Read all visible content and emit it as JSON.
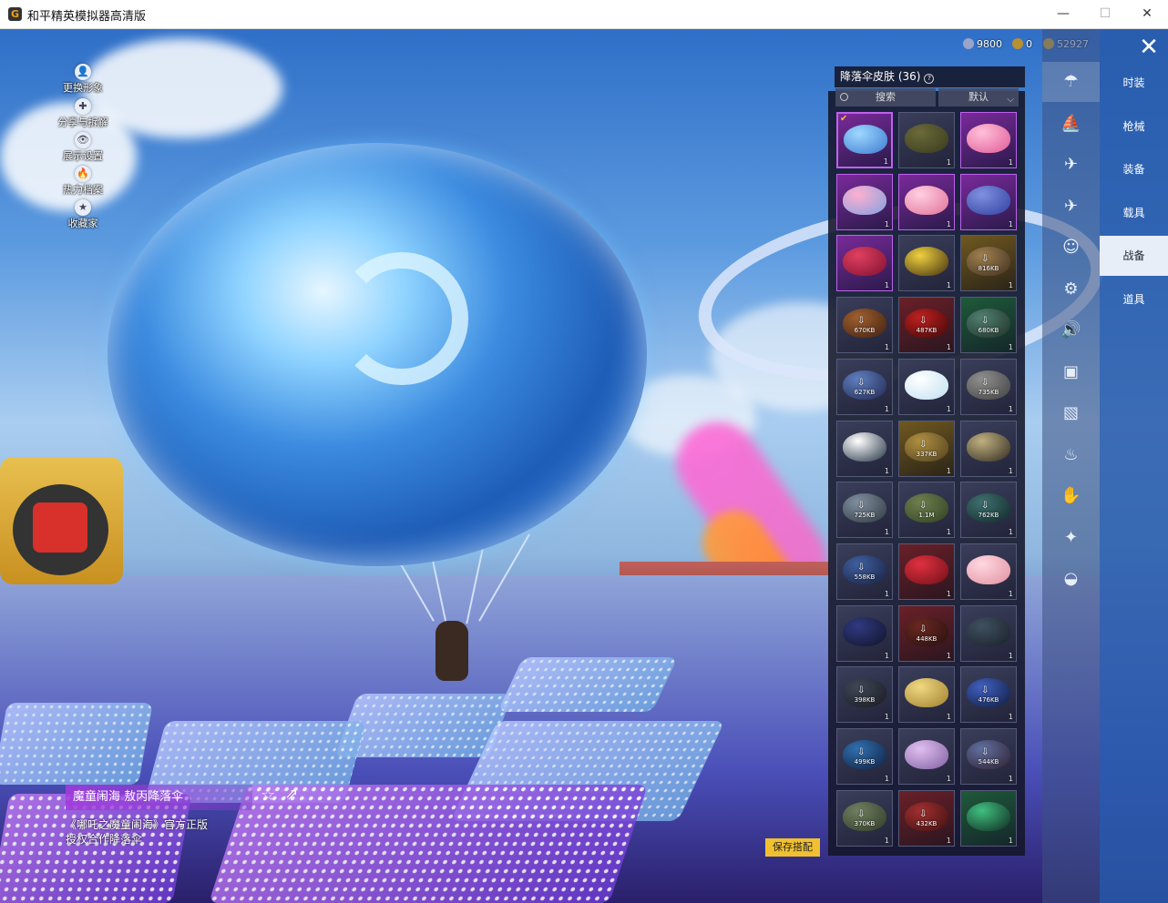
{
  "window": {
    "title": "和平精英模拟器高清版",
    "minimize": "—",
    "maximize": "☐",
    "close": "✕"
  },
  "left_menu": [
    {
      "label": "更换形象",
      "icon": "avatar-icon",
      "glyph": "👤"
    },
    {
      "label": "分享与拆解",
      "icon": "share-split-icon",
      "glyph": "✚"
    },
    {
      "label": "展示设置",
      "icon": "eye-icon",
      "glyph": "👁"
    },
    {
      "label": "热力档案",
      "icon": "flame-icon",
      "glyph": "🔥"
    },
    {
      "label": "收藏家",
      "icon": "collector-icon",
      "glyph": "★"
    }
  ],
  "currency": {
    "gems": "9800",
    "tokens": "0",
    "coins": "52927"
  },
  "panel": {
    "title": "降落伞皮肤 (36)",
    "help": "?",
    "search": "搜索",
    "sort": "默认",
    "sort_chevron": "⌵"
  },
  "skins": [
    {
      "style": "sel-blue",
      "size": "",
      "count": "1",
      "selected": true
    },
    {
      "style": "olive",
      "size": "",
      "count": "1"
    },
    {
      "style": "pink",
      "size": "",
      "count": "1"
    },
    {
      "style": "pink2",
      "size": "",
      "count": "1"
    },
    {
      "style": "pink3",
      "size": "",
      "count": "1"
    },
    {
      "style": "violet",
      "size": "",
      "count": "1"
    },
    {
      "style": "red",
      "size": "",
      "count": "1"
    },
    {
      "style": "yellow",
      "size": "",
      "count": "1"
    },
    {
      "style": "gold",
      "size": "816KB",
      "count": "1",
      "download": true
    },
    {
      "style": "brown",
      "size": "670KB",
      "count": "1",
      "download": true
    },
    {
      "style": "red2",
      "size": "487KB",
      "count": "1",
      "download": true
    },
    {
      "style": "green",
      "size": "680KB",
      "count": "1",
      "download": true
    },
    {
      "style": "navy",
      "size": "627KB",
      "count": "1",
      "download": true
    },
    {
      "style": "white",
      "size": "",
      "count": "1"
    },
    {
      "style": "grey",
      "size": "735KB",
      "count": "1",
      "download": true
    },
    {
      "style": "bw",
      "size": "",
      "count": "1"
    },
    {
      "style": "gold2",
      "size": "337KB",
      "count": "1",
      "download": true
    },
    {
      "style": "dark",
      "size": "",
      "count": "1"
    },
    {
      "style": "grey2",
      "size": "725KB",
      "count": "1",
      "download": true
    },
    {
      "style": "camo",
      "size": "1.1M",
      "count": "1",
      "download": true
    },
    {
      "style": "teal",
      "size": "762KB",
      "count": "1",
      "download": true
    },
    {
      "style": "navy2",
      "size": "558KB",
      "count": "1",
      "download": true
    },
    {
      "style": "red3",
      "size": "",
      "count": "1"
    },
    {
      "style": "pink4",
      "size": "",
      "count": "1"
    },
    {
      "style": "navy3",
      "size": "",
      "count": "1"
    },
    {
      "style": "maroon",
      "size": "448KB",
      "count": "1",
      "download": true
    },
    {
      "style": "slate",
      "size": "",
      "count": "1"
    },
    {
      "style": "dark2",
      "size": "398KB",
      "count": "1",
      "download": true
    },
    {
      "style": "yellow2",
      "size": "",
      "count": "1"
    },
    {
      "style": "blue2",
      "size": "476KB",
      "count": "1",
      "download": true
    },
    {
      "style": "blue3",
      "size": "499KB",
      "count": "1",
      "download": true
    },
    {
      "style": "lavender",
      "size": "",
      "count": "1"
    },
    {
      "style": "mixed",
      "size": "544KB",
      "count": "1",
      "download": true
    },
    {
      "style": "camo2",
      "size": "370KB",
      "count": "1",
      "download": true
    },
    {
      "style": "red4",
      "size": "432KB",
      "count": "1",
      "download": true
    },
    {
      "style": "green2",
      "size": "",
      "count": "1"
    }
  ],
  "icon_tabs": [
    {
      "icon": "parachute-icon",
      "glyph": "☂",
      "active": true
    },
    {
      "icon": "boat-icon",
      "glyph": "⛵"
    },
    {
      "icon": "plane-icon",
      "glyph": "✈"
    },
    {
      "icon": "jet-icon",
      "glyph": "✈"
    },
    {
      "icon": "emote-icon",
      "glyph": "☺"
    },
    {
      "icon": "robot-icon",
      "glyph": "⚙"
    },
    {
      "icon": "sound-icon",
      "glyph": "🔊"
    },
    {
      "icon": "face-icon",
      "glyph": "▣"
    },
    {
      "icon": "picture-icon",
      "glyph": "▧"
    },
    {
      "icon": "extinguisher-icon",
      "glyph": "♨"
    },
    {
      "icon": "clap-icon",
      "glyph": "✋"
    },
    {
      "icon": "wand-icon",
      "glyph": "✦"
    },
    {
      "icon": "helmet-icon",
      "glyph": "◒"
    }
  ],
  "categories": [
    {
      "label": "时装"
    },
    {
      "label": "枪械"
    },
    {
      "label": "装备"
    },
    {
      "label": "载具"
    },
    {
      "label": "战备",
      "active": true
    },
    {
      "label": "道具"
    }
  ],
  "close_button": "✕",
  "item": {
    "name": "魔童闹海 敖丙降落伞",
    "desc": "《哪吒之魔童闹海》官方正版授权合作降落伞",
    "star": "☆",
    "share": "⇗"
  },
  "save_label": "保存搭配",
  "colors": {
    "accent_gold": "#f0c030",
    "category_blue": "#2860b0",
    "panel_bg": "#141628",
    "item_purple": "#a03cdc"
  }
}
